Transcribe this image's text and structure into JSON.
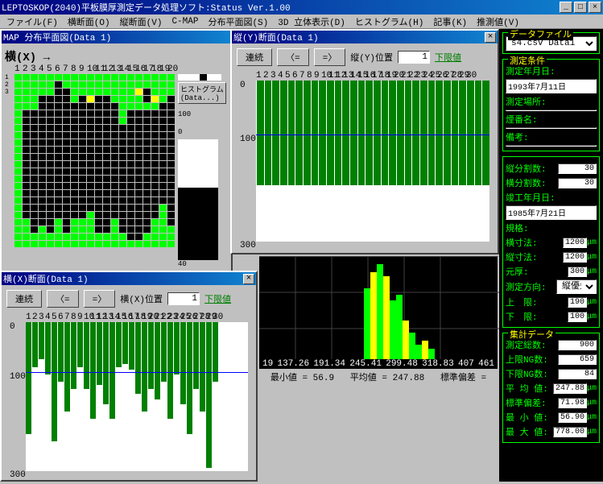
{
  "title": "LEPTOSKOP(2040)平板膜厚測定データ処理ソフト:Status Ver.1.00",
  "menu": [
    "ファイル(F)",
    "横断面(O)",
    "縦断面(V)",
    "C-MAP",
    "分布平面図(S)",
    "3D 立体表示(D)",
    "ヒストグラム(H)",
    "記事(K)",
    "推測値(V)"
  ],
  "map": {
    "title": "MAP 分布平面図(Data 1)",
    "axis_label": "横(X) →",
    "ticks": [
      1,
      2,
      3,
      4,
      5,
      6,
      7,
      8,
      9,
      10,
      11,
      12,
      13,
      14,
      15,
      16,
      17,
      18,
      19,
      20
    ],
    "legend": "ヒストグラム(Data...)",
    "legend_vals": [
      100,
      0
    ],
    "cells": [
      "GGGGGGGGGGGGGGGGGGGG",
      "GGGGGBGGGGGGGGGGGGGG",
      "GGGGGBBGGGGGGGGYBGGG",
      "GGGBBBBGBYBBGGGGBYGB",
      "GGGBBBBBBBBBBGGGGGBB",
      "GBBBBBBBBBBBBGBBBBBB",
      "GBBBBBBBBBBBBGBBBBBB",
      "GBBBBBBBBBBBBBBBBBBB",
      "GBBBBBBBBBBBBBBBBBBB",
      "GBBBBBBBBBBBBBBBBBBB",
      "GBBBBBBBBBBBBBBBBBBB",
      "GBBBBBBBBBBBBBBBBBBB",
      "GBBBBBBBBBBBBBBBBBBB",
      "GBBBBBBBBBBBBBBBBBBB",
      "GBBBBBBBBBBBBBBBBBBB",
      "GBBBBBBBBBBBBBBBBBBB",
      "GBBBBBBBBBBBBBBBBBBB",
      "GBBBBBBBBBBBBBBBBBBB",
      "GBBBBBBBBBBBBBBBBBGB",
      "GBBBBBBBBGBBBBBBBBGB",
      "GGBBBGBGGGBBGBBBBGGB",
      "GGBGBGBGGGBBGBBBBGGG",
      "GGGGGGGGGGGGGGBBGGGG",
      "GGGGGGGGGGGGGGGGGGGG"
    ]
  },
  "tate": {
    "title": "縦(Y)断面(Data 1)",
    "btns": {
      "cont": "連続",
      "prev": "〈=",
      "next": "=〉"
    },
    "pos_label": "縦(Y)位置",
    "pos_val": "1",
    "limit": "下限値",
    "yticks": [
      0,
      100,
      300
    ],
    "ticks": [
      1,
      2,
      3,
      4,
      5,
      6,
      7,
      8,
      9,
      10,
      11,
      12,
      13,
      14,
      15,
      16,
      17,
      18,
      19,
      20,
      21,
      22,
      23,
      24,
      25,
      26,
      27,
      28,
      29,
      30
    ]
  },
  "yoko": {
    "title": "横(X)断面(Data 1)",
    "btns": {
      "cont": "連続",
      "prev": "〈=",
      "next": "=〉"
    },
    "pos_label": "横(X)位置",
    "pos_val": "1",
    "limit": "下限値",
    "yticks": [
      0,
      100,
      300
    ],
    "ticks": [
      1,
      2,
      3,
      4,
      5,
      6,
      7,
      8,
      9,
      10,
      11,
      12,
      13,
      14,
      15,
      16,
      17,
      18,
      19,
      20,
      21,
      22,
      23,
      24,
      25,
      26,
      27,
      28,
      29,
      30
    ],
    "bars": [
      75,
      30,
      25,
      35,
      80,
      40,
      60,
      45,
      30,
      45,
      65,
      42,
      55,
      65,
      30,
      28,
      32,
      48,
      60,
      45,
      52,
      40,
      65,
      35,
      55,
      75,
      45,
      60,
      98,
      40
    ]
  },
  "hist": {
    "xticks": [
      "19",
      "137.26",
      "191.34",
      "245.41",
      "299.48",
      "318.83",
      "407",
      "461"
    ],
    "stats": {
      "min_label": "最小値 =",
      "min": "56.9",
      "avg_label": "平均値 =",
      "avg": "247.88",
      "std_label": "標準偏差 =",
      "std": ""
    }
  },
  "right": {
    "file": {
      "title": "データファイル",
      "val": "s4.csv  Data1"
    },
    "cond": {
      "title": "測定条件",
      "date_label": "測定年月日:",
      "date": "1993年7月11日",
      "place_label": "測定場所:",
      "place": "",
      "no_label": "煙番名:",
      "no": "",
      "note_label": "備考:",
      "note": ""
    },
    "split": {
      "xdiv_label": "縦分割数:",
      "xdiv": "30",
      "ydiv_label": "横分割数:",
      "ydiv": "30",
      "startdate_label": "竣工年月日:",
      "startdate": "1985年7月21日",
      "std_label": "規格:",
      "std": "",
      "xdim_label": "横寸法:",
      "xdim": "1200",
      "xdim_unit": "μm",
      "ydim_label": "縦寸法:",
      "ydim": "1200",
      "ydim_unit": "μm",
      "orig_label": "元厚:",
      "orig": "300",
      "orig_unit": "μm",
      "dir_label": "測定方向:",
      "dir": "縦優先",
      "up_label": "上　限:",
      "up": "190",
      "up_unit": "μm",
      "low_label": "下　限:",
      "low": "100",
      "low_unit": "μm"
    },
    "stats": {
      "title": "集計データ",
      "count_label": "測定総数:",
      "count": "900",
      "upng_label": "上限NG数:",
      "upng": "659",
      "lowng_label": "下限NG数:",
      "lowng": "84",
      "avg_label": "平 均 値:",
      "avg": "247.88",
      "avg_unit": "μm",
      "std_label": "標準偏差:",
      "std": "71.98",
      "std_unit": "μm",
      "min_label": "最 小 値:",
      "min": "56.90",
      "min_unit": "μm",
      "max_label": "最 大 値:",
      "max": "778.00",
      "max_unit": "μm"
    }
  }
}
